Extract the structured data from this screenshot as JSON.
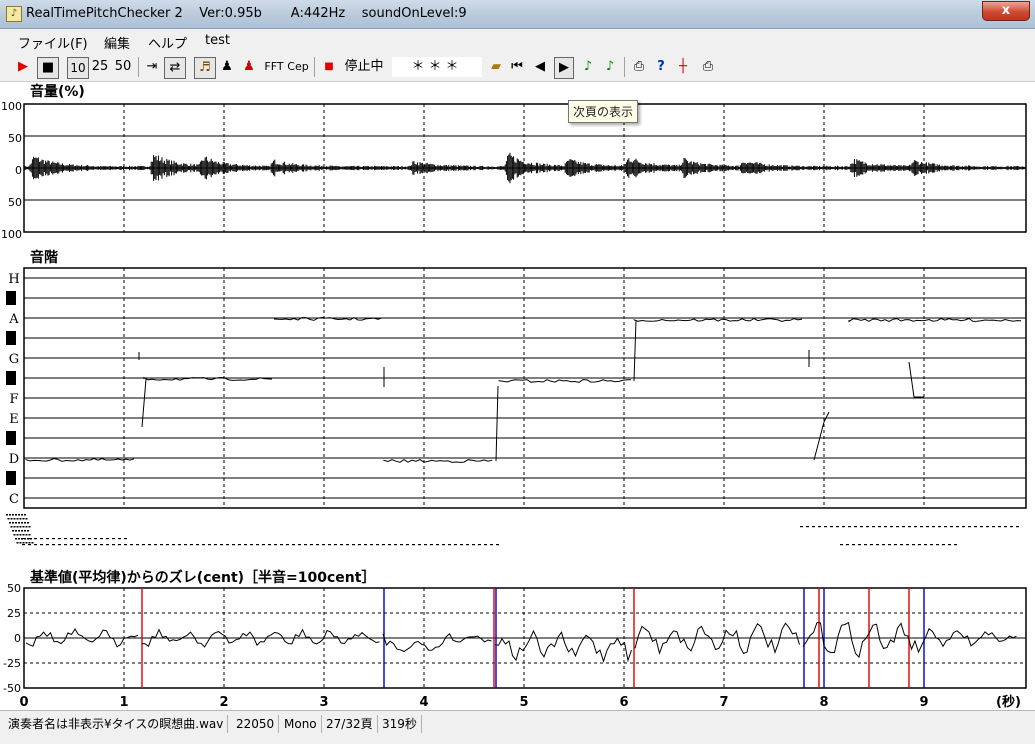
{
  "window": {
    "title": "RealTimePitchChecker 2    Ver:0.95b       A:442Hz    soundOnLevel:9",
    "close_label": "x",
    "app_icon": "tuning-fork-icon"
  },
  "menu": [
    "ファイル(F)",
    "編集",
    "ヘルプ",
    "test"
  ],
  "toolbar": {
    "play_icon": "play-icon",
    "stop_icon": "stop-icon",
    "speed_10": "10",
    "speed_25": "25",
    "speed_50": "50",
    "jump_icon": "jump-to-end-icon",
    "loop_icon": "loop-icon",
    "violin_icon": "violin-icon",
    "person_icon": "player-icon",
    "person2_icon": "singer-icon",
    "fft_label": "FFT",
    "cep_label": "Cep",
    "record_icon": "record-stop-icon",
    "status_label": "停止中",
    "stars_label": "＊＊＊",
    "open_icon": "open-folder-icon",
    "first_icon": "first-page-icon",
    "prev_icon": "previous-page-icon",
    "next_icon": "next-page-icon",
    "note_icon": "music-note-icon",
    "note2_icon": "music-note-2-icon",
    "print_icon": "print-icon",
    "help_icon": "help-icon",
    "marker_icon": "marker-icon",
    "print2_icon": "print-preview-icon"
  },
  "tooltip": "次頁の表示",
  "volume_panel": {
    "title": "音量(%)",
    "tick_labels": [
      "100",
      "50",
      "0",
      "50",
      "100"
    ]
  },
  "scale_panel": {
    "title": "音階",
    "note_labels": [
      "H",
      "A",
      "G",
      "F",
      "E",
      "D",
      "C"
    ]
  },
  "cent_panel": {
    "title": "基準値(平均律)からのズレ(cent)［半音=100cent］",
    "tick_labels": [
      "50",
      "25",
      "0",
      "-25",
      "-50"
    ]
  },
  "time_axis": {
    "labels": [
      "0",
      "1",
      "2",
      "3",
      "4",
      "5",
      "6",
      "7",
      "8",
      "9"
    ],
    "unit": "(秒)"
  },
  "statusbar": {
    "filename": "演奏者名は非表示¥タイスの瞑想曲.wav",
    "rate": "22050",
    "channels": "Mono",
    "page": "27/32頁",
    "length": "319秒"
  },
  "colors": {
    "trace": "#000000",
    "marker_red": "#e00000",
    "marker_blue": "#0000cc"
  }
}
